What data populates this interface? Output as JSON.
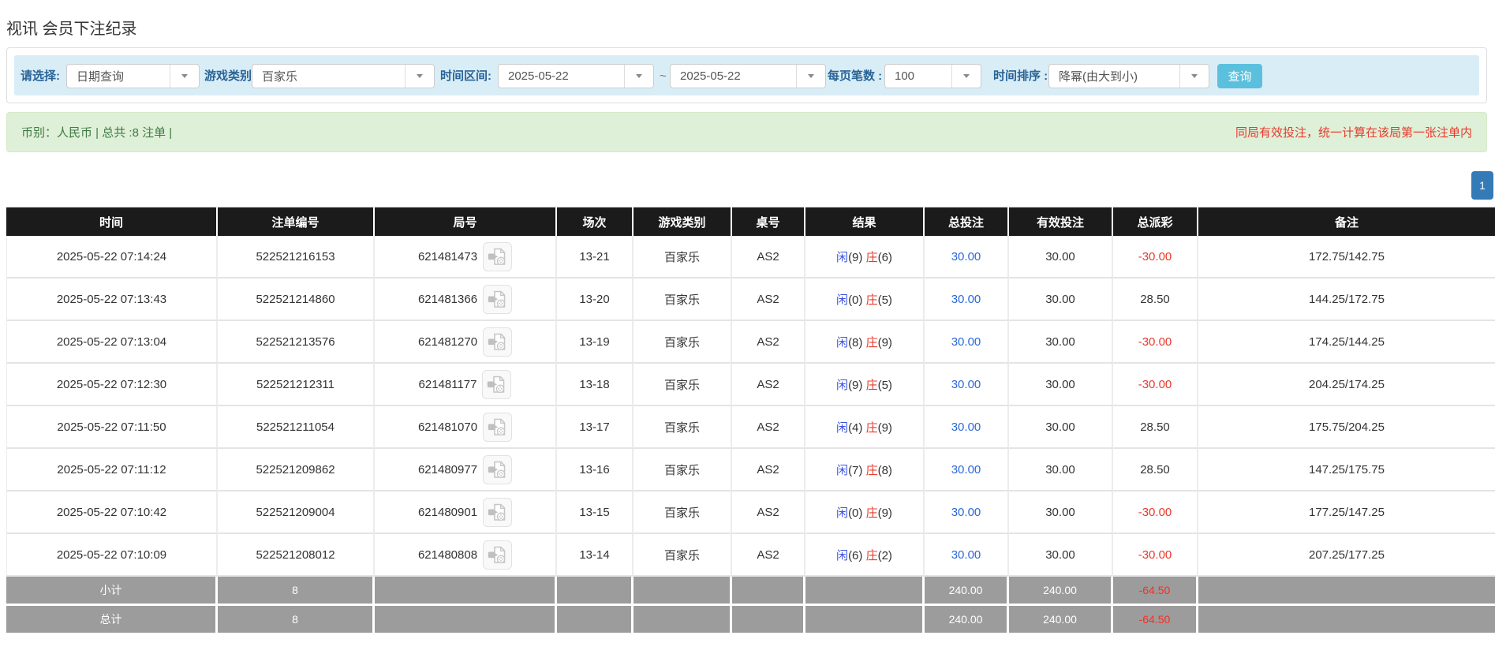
{
  "title": "视讯 会员下注纪录",
  "filters": {
    "select_label": "请选择:",
    "select_value": "日期查询",
    "game_label": "游戏类别",
    "game_value": "百家乐",
    "range_label": "时间区间:",
    "date_from": "2025-05-22",
    "tilde": "~",
    "date_to": "2025-05-22",
    "page_size_label": "每页笔数 :",
    "page_size_value": "100",
    "sort_label": "时间排序 :",
    "sort_value": "降幂(由大到小)",
    "search_button": "查询"
  },
  "summary": {
    "left_text": "币别：人民币 | 总共 :8 注单 |",
    "right_notice": "同局有效投注，统一计算在该局第一张注单内"
  },
  "pagination": {
    "page": "1"
  },
  "table": {
    "headers": [
      "时间",
      "注单编号",
      "局号",
      "场次",
      "游戏类别",
      "桌号",
      "结果",
      "总投注",
      "有效投注",
      "总派彩",
      "备注"
    ],
    "rows": [
      {
        "time": "2025-05-22 07:14:24",
        "bet_no": "522521216153",
        "round_no": "621481473",
        "session": "13-21",
        "game": "百家乐",
        "table_no": "AS2",
        "result": {
          "p": "闲",
          "pv": "(9)",
          "b": "庄",
          "bv": "(6)"
        },
        "total_bet": "30.00",
        "valid_bet": "30.00",
        "payout": "-30.00",
        "remark": "172.75/142.75"
      },
      {
        "time": "2025-05-22 07:13:43",
        "bet_no": "522521214860",
        "round_no": "621481366",
        "session": "13-20",
        "game": "百家乐",
        "table_no": "AS2",
        "result": {
          "p": "闲",
          "pv": "(0)",
          "b": "庄",
          "bv": "(5)"
        },
        "total_bet": "30.00",
        "valid_bet": "30.00",
        "payout": "28.50",
        "remark": "144.25/172.75"
      },
      {
        "time": "2025-05-22 07:13:04",
        "bet_no": "522521213576",
        "round_no": "621481270",
        "session": "13-19",
        "game": "百家乐",
        "table_no": "AS2",
        "result": {
          "p": "闲",
          "pv": "(8)",
          "b": "庄",
          "bv": "(9)"
        },
        "total_bet": "30.00",
        "valid_bet": "30.00",
        "payout": "-30.00",
        "remark": "174.25/144.25"
      },
      {
        "time": "2025-05-22 07:12:30",
        "bet_no": "522521212311",
        "round_no": "621481177",
        "session": "13-18",
        "game": "百家乐",
        "table_no": "AS2",
        "result": {
          "p": "闲",
          "pv": "(9)",
          "b": "庄",
          "bv": "(5)"
        },
        "total_bet": "30.00",
        "valid_bet": "30.00",
        "payout": "-30.00",
        "remark": "204.25/174.25"
      },
      {
        "time": "2025-05-22 07:11:50",
        "bet_no": "522521211054",
        "round_no": "621481070",
        "session": "13-17",
        "game": "百家乐",
        "table_no": "AS2",
        "result": {
          "p": "闲",
          "pv": "(4)",
          "b": "庄",
          "bv": "(9)"
        },
        "total_bet": "30.00",
        "valid_bet": "30.00",
        "payout": "28.50",
        "remark": "175.75/204.25"
      },
      {
        "time": "2025-05-22 07:11:12",
        "bet_no": "522521209862",
        "round_no": "621480977",
        "session": "13-16",
        "game": "百家乐",
        "table_no": "AS2",
        "result": {
          "p": "闲",
          "pv": "(7)",
          "b": "庄",
          "bv": "(8)"
        },
        "total_bet": "30.00",
        "valid_bet": "30.00",
        "payout": "28.50",
        "remark": "147.25/175.75"
      },
      {
        "time": "2025-05-22 07:10:42",
        "bet_no": "522521209004",
        "round_no": "621480901",
        "session": "13-15",
        "game": "百家乐",
        "table_no": "AS2",
        "result": {
          "p": "闲",
          "pv": "(0)",
          "b": "庄",
          "bv": "(9)"
        },
        "total_bet": "30.00",
        "valid_bet": "30.00",
        "payout": "-30.00",
        "remark": "177.25/147.25"
      },
      {
        "time": "2025-05-22 07:10:09",
        "bet_no": "522521208012",
        "round_no": "621480808",
        "session": "13-14",
        "game": "百家乐",
        "table_no": "AS2",
        "result": {
          "p": "闲",
          "pv": "(6)",
          "b": "庄",
          "bv": "(2)"
        },
        "total_bet": "30.00",
        "valid_bet": "30.00",
        "payout": "-30.00",
        "remark": "207.25/177.25"
      }
    ],
    "subtotal": {
      "label": "小计",
      "count": "8",
      "total_bet": "240.00",
      "valid_bet": "240.00",
      "payout": "-64.50"
    },
    "total": {
      "label": "总计",
      "count": "8",
      "total_bet": "240.00",
      "valid_bet": "240.00",
      "payout": "-64.50"
    }
  },
  "icons": {
    "round_video": "video-file-icon"
  },
  "colors": {
    "header_bg": "#1b1b1b",
    "footer_bg": "#9c9c9c",
    "bar_blue": "#d9edf7",
    "bar_green": "#dff0d8",
    "label_blue": "#2a6496",
    "blue_link": "#2b68db",
    "blue_p": "#3b52e0",
    "red": "#e8392c",
    "btn_cyan": "#5bc0de",
    "pag_blue": "#337ab7"
  }
}
